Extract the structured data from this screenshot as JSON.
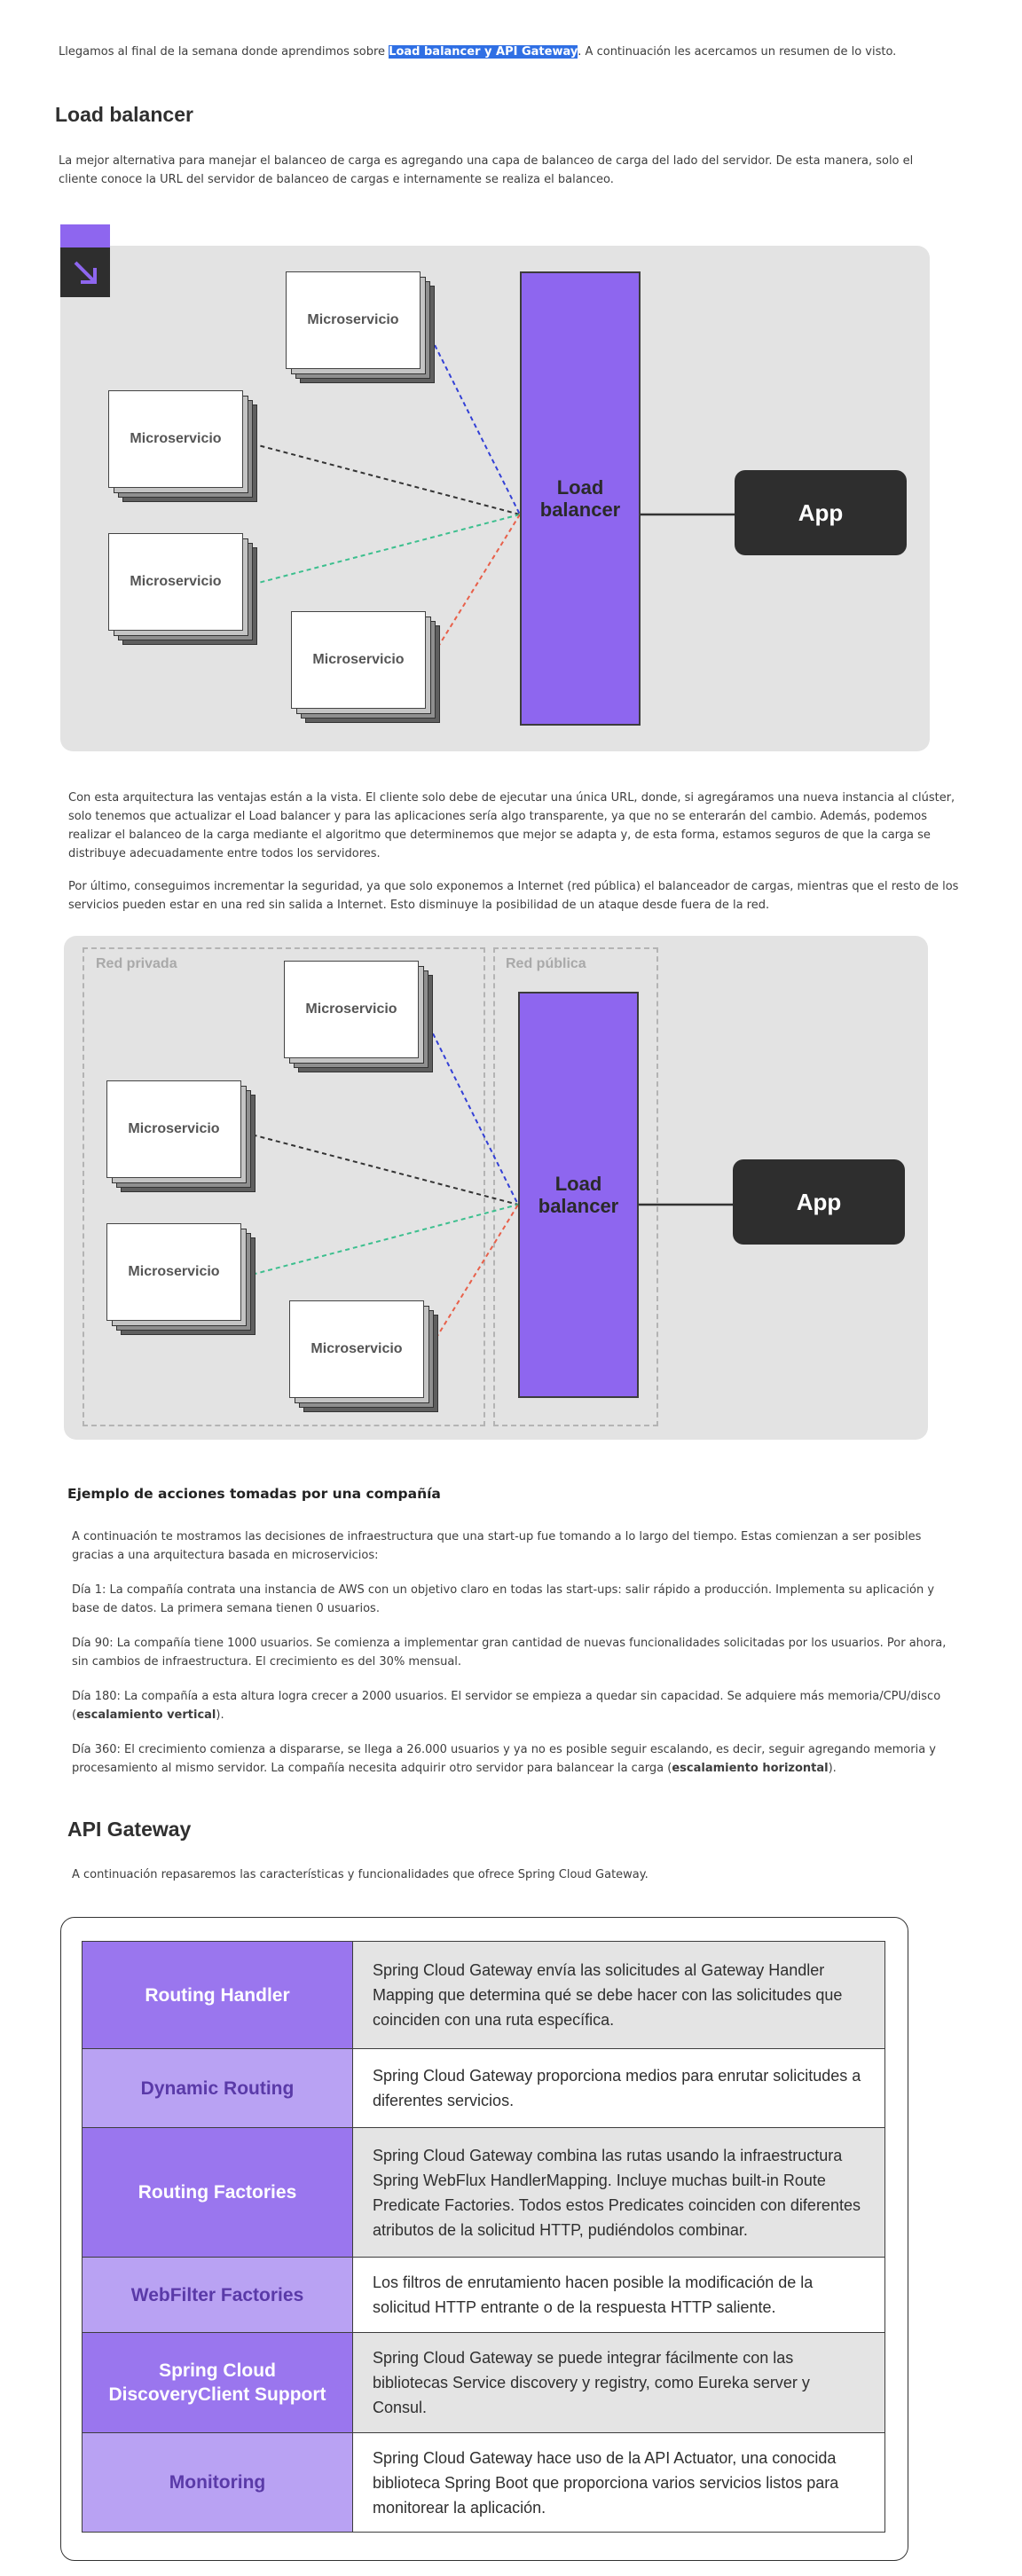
{
  "intro": {
    "before": "Llegamos al final de la semana donde aprendimos sobre ",
    "highlight": "Load balancer y API Gateway",
    "after": ". A continuación les acercamos un resumen de lo visto."
  },
  "load_balancer": {
    "title": "Load balancer",
    "description": "La mejor alternativa para manejar el balanceo de carga es agregando una capa de balanceo de carga del lado del servidor. De esta manera, solo el cliente conoce la URL del servidor de balanceo de cargas e internamente se realiza el balanceo.",
    "paragraph_advantages": "Con esta arquitectura las ventajas están a la vista. El cliente solo debe de ejecutar una única URL, donde, si agregáramos una nueva instancia al clúster, solo tenemos que actualizar el Load balancer y para las aplicaciones sería algo transparente, ya que no se enterarán del cambio. Además, podemos realizar el balanceo de la carga mediante el algoritmo que determinemos que mejor se adapta y, de esta forma, estamos seguros de que la carga se distribuye adecuadamente entre todos los servidores.",
    "paragraph_security": "Por último, conseguimos incrementar la seguridad, ya que solo exponemos a Internet (red pública) el balanceador de cargas, mientras que el resto de los servicios pueden estar en una red sin salida a Internet. Esto disminuye la posibilidad de un ataque desde fuera de la red."
  },
  "diagram": {
    "microservice_label": "Microservicio",
    "load_balancer_label": "Load balancer",
    "app_label": "App",
    "private_network_label": "Red privada",
    "public_network_label": "Red pública",
    "link_colors": [
      "#3340d6",
      "#333333",
      "#3cbf8e",
      "#e8604a"
    ],
    "accent_color": "#8e66ef",
    "corner_icon": "arrow-down-right-icon"
  },
  "company_example": {
    "title": "Ejemplo de acciones tomadas por una compañía",
    "intro": "A continuación te mostramos las decisiones de infraestructura que una start-up fue tomando a lo largo del tiempo. Estas comienzan a ser posibles gracias a una arquitectura basada en microservicios:",
    "day1": "Día 1: La compañía contrata una instancia de AWS con un objetivo claro en todas las start-ups: salir rápido a producción. Implementa su aplicación y base de datos. La primera semana tienen 0 usuarios.",
    "day90": "Día 90: La compañía tiene 1000 usuarios. Se comienza a implementar gran cantidad de nuevas funcionalidades solicitadas por los usuarios. Por ahora, sin cambios de infraestructura. El crecimiento es del 30% mensual.",
    "day180_text": "Día 180: La compañía a esta altura logra crecer a 2000 usuarios. El servidor se empieza a quedar sin capacidad. Se adquiere más memoria/CPU/disco (",
    "day180_bold": "escalamiento vertical",
    "day180_end": ").",
    "day360_text": "Día 360: El crecimiento comienza a dispararse, se llega a 26.000 usuarios y ya no es posible seguir escalando, es decir, seguir agregando memoria y procesamiento al mismo servidor. La compañía necesita adquirir otro servidor para balancear la carga (",
    "day360_bold": "escalamiento horizontal",
    "day360_end": ")."
  },
  "api_gateway": {
    "title": "API Gateway",
    "intro": "A continuación repasaremos las características y funcionalidades que ofrece Spring Cloud Gateway.",
    "features": [
      {
        "name": "Routing Handler",
        "description": "Spring Cloud Gateway envía las solicitudes al Gateway Handler Mapping que determina qué se debe hacer con las solicitudes que coinciden con una ruta específica."
      },
      {
        "name": "Dynamic Routing",
        "description": "Spring Cloud Gateway proporciona medios para enrutar solicitudes a diferentes servicios."
      },
      {
        "name": "Routing Factories",
        "description": "Spring Cloud Gateway combina las rutas usando la infraestructura Spring WebFlux HandlerMapping. Incluye muchas built-in Route Predicate Factories. Todos estos Predicates coinciden con diferentes atributos de la solicitud HTTP, pudiéndolos combinar."
      },
      {
        "name": "WebFilter Factories",
        "description": "Los filtros de enrutamiento hacen posible la modificación de la solicitud HTTP entrante o de la respuesta HTTP saliente."
      },
      {
        "name": "Spring Cloud DiscoveryClient Support",
        "description": "Spring Cloud Gateway se puede integrar fácilmente con las bibliotecas Service discovery y registry, como Eureka server y Consul."
      },
      {
        "name": "Monitoring",
        "description": "Spring Cloud Gateway hace uso de la API Actuator, una conocida biblioteca Spring Boot que proporciona varios servicios listos para monitorear la aplicación."
      }
    ]
  }
}
